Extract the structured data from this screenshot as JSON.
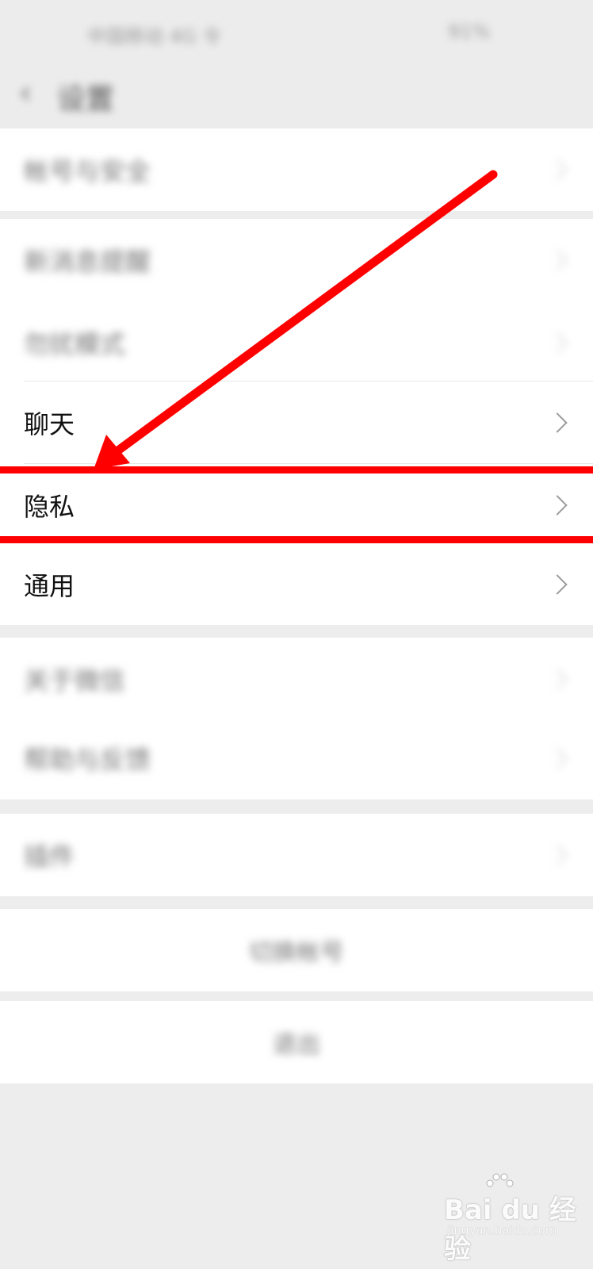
{
  "status_bar": {
    "left_text": "中国移动 4G 令",
    "right_text": "91%"
  },
  "nav": {
    "title": "设置"
  },
  "groups": {
    "top": {
      "label": "帐号与安全"
    },
    "middle": [
      {
        "label": "新消息提醒"
      },
      {
        "label": "勿扰模式"
      },
      {
        "label": "聊天"
      },
      {
        "label": "隐私"
      },
      {
        "label": "通用"
      }
    ],
    "lower": [
      {
        "label": "关于微信"
      },
      {
        "label": "帮助与反馈"
      }
    ],
    "plugins": {
      "label": "插件"
    }
  },
  "actions": {
    "switch_account": "切换帐号",
    "logout": "退出"
  },
  "watermark": {
    "brand": "Bai du 经验",
    "url": "jingyan.baidu.com"
  },
  "colors": {
    "annotation": "#ff0000",
    "background": "#ededed",
    "row": "#ffffff"
  }
}
